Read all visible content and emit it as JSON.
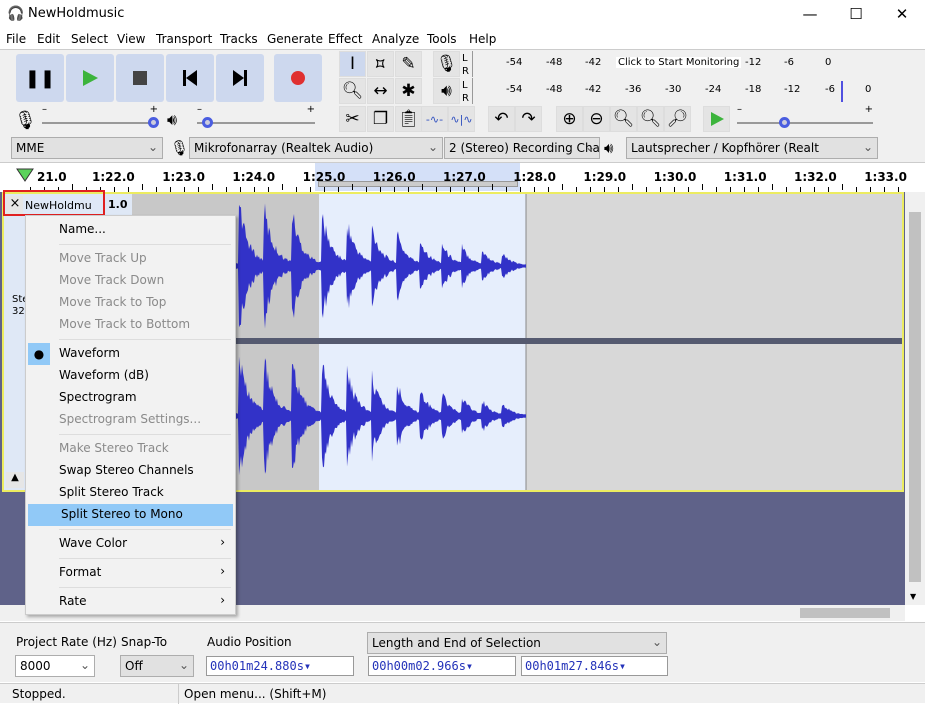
{
  "window": {
    "title": "NewHoldmusic",
    "minimize": "—",
    "maximize": "☐",
    "close": "✕"
  },
  "menu": [
    "File",
    "Edit",
    "Select",
    "View",
    "Transport",
    "Tracks",
    "Generate",
    "Effect",
    "Analyze",
    "Tools",
    "Help"
  ],
  "meters": {
    "record_ticks": [
      "-54",
      "-48",
      "-42",
      "-18",
      "-12",
      "-6",
      "0"
    ],
    "monitor_label": "Click to Start Monitoring",
    "play_ticks": [
      "-54",
      "-48",
      "-42",
      "-36",
      "-30",
      "-24",
      "-18",
      "-12",
      "-6",
      "0"
    ],
    "L": "L",
    "R": "R"
  },
  "sliders": {
    "minus": "–",
    "plus": "+",
    "record_volume": 1.0,
    "play_volume": 0.05,
    "play_speed": 0.33
  },
  "devices": {
    "host": "MME",
    "input": "Mikrofonarray (Realtek Audio)",
    "channels": "2 (Stereo) Recording Chai",
    "output": "Lautsprecher / Kopfhörer (Realt"
  },
  "timeline": {
    "labels": [
      "21.0",
      "1:22.0",
      "1:23.0",
      "1:24.0",
      "1:25.0",
      "1:26.0",
      "1:27.0",
      "1:28.0",
      "1:29.0",
      "1:30.0",
      "1:31.0",
      "1:32.0",
      "1:33.0"
    ]
  },
  "track": {
    "name": "NewHoldmu",
    "scale_top": "1.0",
    "close": "×",
    "mute_partial": "M",
    "info1": "Ste",
    "info2": "32-",
    "collapse": "▲"
  },
  "track_menu": {
    "items": [
      {
        "label": "Name...",
        "enabled": true
      },
      {
        "sep": true
      },
      {
        "label": "Move Track Up",
        "enabled": false
      },
      {
        "label": "Move Track Down",
        "enabled": false
      },
      {
        "label": "Move Track to Top",
        "enabled": false
      },
      {
        "label": "Move Track to Bottom",
        "enabled": false
      },
      {
        "sep": true
      },
      {
        "label": "Waveform",
        "enabled": true,
        "checked": true
      },
      {
        "label": "Waveform (dB)",
        "enabled": true
      },
      {
        "label": "Spectrogram",
        "enabled": true
      },
      {
        "label": "Spectrogram Settings...",
        "enabled": false
      },
      {
        "sep": true
      },
      {
        "label": "Make Stereo Track",
        "enabled": false
      },
      {
        "label": "Swap Stereo Channels",
        "enabled": true
      },
      {
        "label": "Split Stereo Track",
        "enabled": true
      },
      {
        "label": "Split Stereo to Mono",
        "enabled": true,
        "highlighted": true
      },
      {
        "sep": true
      },
      {
        "label": "Wave Color",
        "enabled": true,
        "submenu": true
      },
      {
        "sep": true
      },
      {
        "label": "Format",
        "enabled": true,
        "submenu": true
      },
      {
        "sep": true
      },
      {
        "label": "Rate",
        "enabled": true,
        "submenu": true
      }
    ]
  },
  "selection_bar": {
    "project_rate_label": "Project Rate (Hz)",
    "project_rate": "8000",
    "snap_label": "Snap-To",
    "snap": "Off",
    "audio_position_label": "Audio Position",
    "audio_position": "00h01m24.880s",
    "selection_mode": "Length and End of Selection",
    "length": "00h00m02.966s",
    "end": "00h01m27.846s"
  },
  "status": {
    "state": "Stopped.",
    "hint": "Open menu... (Shift+M)"
  },
  "colors": {
    "waveform": "#3232c8",
    "selection": "#e6eefc",
    "accent_red": "#e03030",
    "play_green": "#3cb43c",
    "track_border": "#ecec60"
  }
}
